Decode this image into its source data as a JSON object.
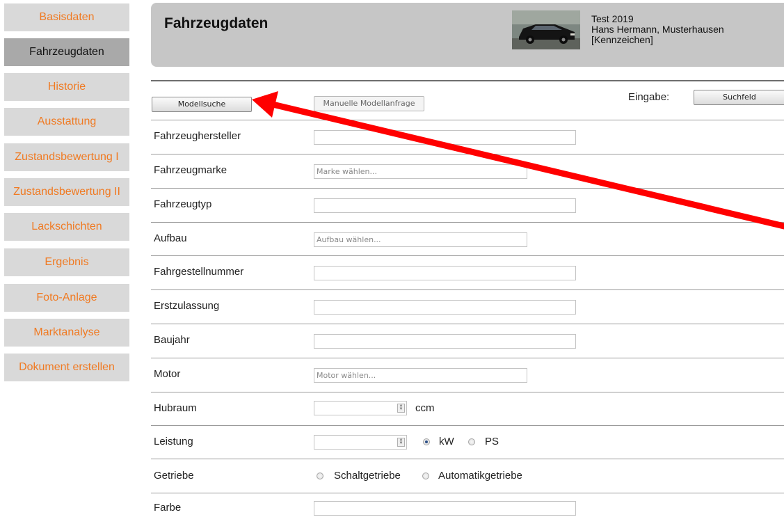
{
  "sidebar": {
    "items": [
      {
        "label": "Basisdaten"
      },
      {
        "label": "Fahrzeugdaten",
        "active": true
      },
      {
        "label": "Historie"
      },
      {
        "label": "Ausstattung"
      },
      {
        "label": "Zustandsbewertung I"
      },
      {
        "label": "Zustandsbewertung II"
      },
      {
        "label": "Lackschichten"
      },
      {
        "label": "Ergebnis"
      },
      {
        "label": "Foto-Anlage"
      },
      {
        "label": "Marktanalyse"
      },
      {
        "label": "Dokument erstellen"
      }
    ]
  },
  "header": {
    "title": "Fahrzeugdaten",
    "info_line1": "Test 2019",
    "info_line2": "Hans Hermann, Musterhausen",
    "info_line3": "[Kennzeichen]"
  },
  "toolbar": {
    "model_search_label": "Modellsuche",
    "manual_request_label": "Manuelle Modellanfrage",
    "input_label": "Eingabe:",
    "search_field_label": "Suchfeld"
  },
  "form": {
    "manufacturer": {
      "label": "Fahrzeughersteller",
      "value": ""
    },
    "brand": {
      "label": "Fahrzeugmarke",
      "placeholder": "Marke wählen..."
    },
    "type": {
      "label": "Fahrzeugtyp",
      "value": ""
    },
    "body": {
      "label": "Aufbau",
      "placeholder": "Aufbau wählen..."
    },
    "vin": {
      "label": "Fahrgestellnummer",
      "value": ""
    },
    "registration": {
      "label": "Erstzulassung",
      "value": ""
    },
    "year": {
      "label": "Baujahr",
      "value": ""
    },
    "engine": {
      "label": "Motor",
      "placeholder": "Motor wählen..."
    },
    "displacement": {
      "label": "Hubraum",
      "value": "",
      "unit": "ccm"
    },
    "power": {
      "label": "Leistung",
      "value": "",
      "unit_kw": "kW",
      "unit_ps": "PS",
      "selected": "kW"
    },
    "gearbox": {
      "label": "Getriebe",
      "option_manual": "Schaltgetriebe",
      "option_auto": "Automatikgetriebe"
    },
    "color": {
      "label": "Farbe",
      "value": ""
    }
  },
  "colors": {
    "nav_text": "#f07a22",
    "nav_bg": "#d9d9d9",
    "nav_active_bg": "#a9a9a9",
    "header_bg": "#c6c6c6",
    "arrow": "#ff0000"
  }
}
